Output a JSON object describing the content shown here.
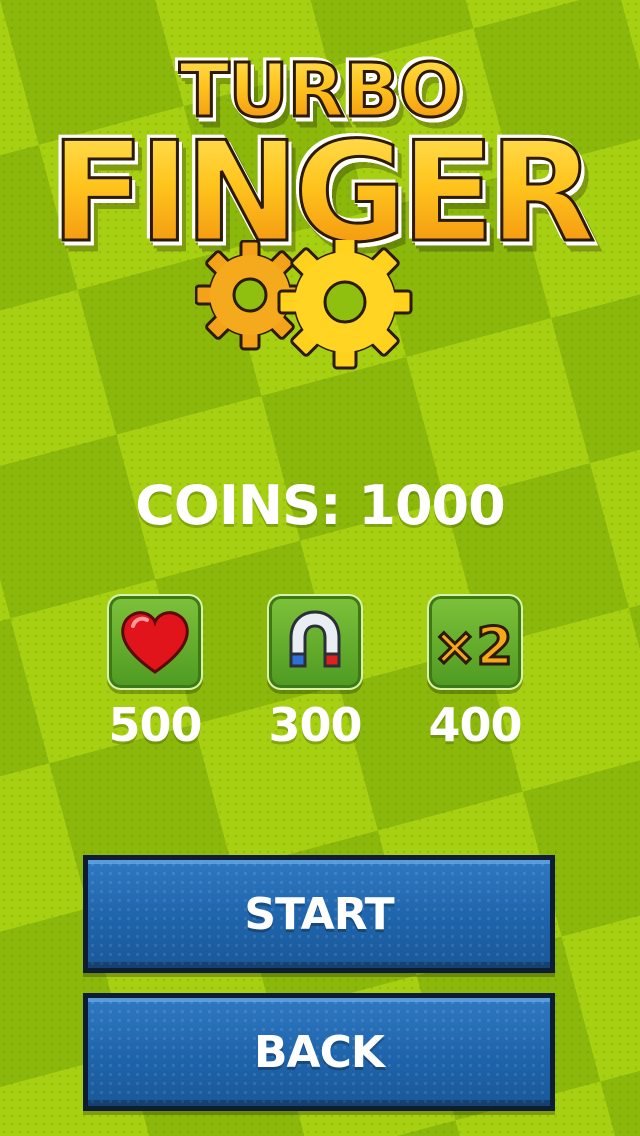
{
  "logo": {
    "line1": "TURBO",
    "line2": "FINGER"
  },
  "coins": {
    "label": "COINS:",
    "value": "1000"
  },
  "powerups": [
    {
      "icon": "heart-icon",
      "price": "500"
    },
    {
      "icon": "magnet-icon",
      "price": "300"
    },
    {
      "icon": "x2-icon",
      "badge": "×2",
      "price": "400"
    }
  ],
  "buttons": {
    "start": "START",
    "back": "BACK"
  },
  "colors": {
    "background_light": "#a4cc0e",
    "background_dark": "#8ab30a",
    "logo_gold": "#f6b417",
    "button_blue": "#1e64ab",
    "button_border": "#0f1d33",
    "text": "#ffffff"
  }
}
